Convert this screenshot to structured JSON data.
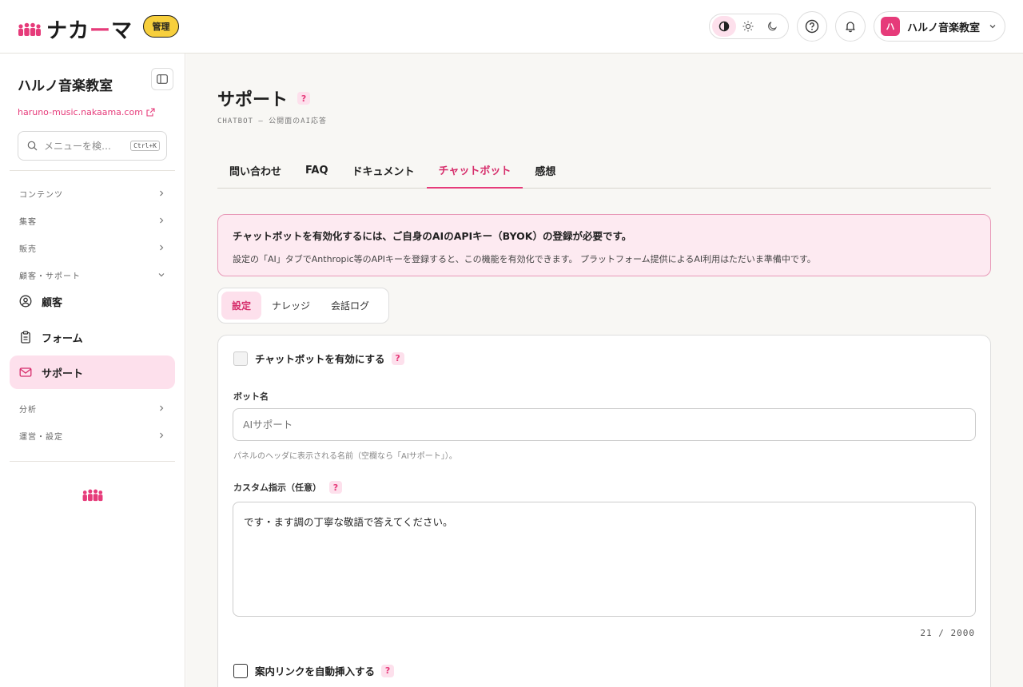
{
  "header": {
    "brand_name_pre": "ナカ",
    "brand_name_accent": "ー",
    "brand_name_post": "マ",
    "admin_badge": "管理",
    "theme_options": [
      "contrast-icon",
      "sun-icon",
      "moon-icon"
    ],
    "tenant_avatar_text": "ハ",
    "tenant_name": "ハルノ音楽教室"
  },
  "sidebar": {
    "title": "ハルノ音楽教室",
    "url": "haruno-music.nakaama.com",
    "search_placeholder": "メニューを検…",
    "search_shortcut": "Ctrl+K",
    "categories": {
      "content": "コンテンツ",
      "marketing": "集客",
      "sales": "販売",
      "customer_support": "顧客・サポート",
      "analytics": "分析",
      "operations": "運営・設定"
    },
    "items": {
      "customers": "顧客",
      "forms": "フォーム",
      "support": "サポート"
    }
  },
  "main": {
    "title": "サポート",
    "help_mark": "?",
    "subtitle": "CHATBOT — 公開面のAI応答",
    "tabs": [
      "問い合わせ",
      "FAQ",
      "ドキュメント",
      "チャットボット",
      "感想"
    ],
    "active_tab": "チャットボット",
    "alert": {
      "title": "チャットボットを有効化するには、ご自身のAIのAPIキー（BYOK）の登録が必要です。",
      "body": "設定の「AI」タブでAnthropic等のAPIキーを登録すると、この機能を有効化できます。 プラットフォーム提供によるAI利用はただいま準備中です。"
    },
    "subtabs": [
      "設定",
      "ナレッジ",
      "会話ログ"
    ],
    "active_subtab": "設定",
    "form": {
      "enable_label": "チャットボットを有効にする",
      "bot_name_label": "ボット名",
      "bot_name_placeholder": "AIサポート",
      "bot_name_hint": "パネルのヘッダに表示される名前（空欄なら「AIサポート」）。",
      "custom_instruction_label": "カスタム指示（任意）",
      "custom_instruction_value": "です・ます調の丁寧な敬語で答えてください。",
      "char_counter": "21 / 2000",
      "auto_link_label": "案内リンクを自動挿入する"
    }
  },
  "colors": {
    "accent": "#e63b7a",
    "accent_light": "#fde0ec",
    "badge_yellow": "#f7cf3d",
    "main_bg": "#f8f7f4"
  }
}
